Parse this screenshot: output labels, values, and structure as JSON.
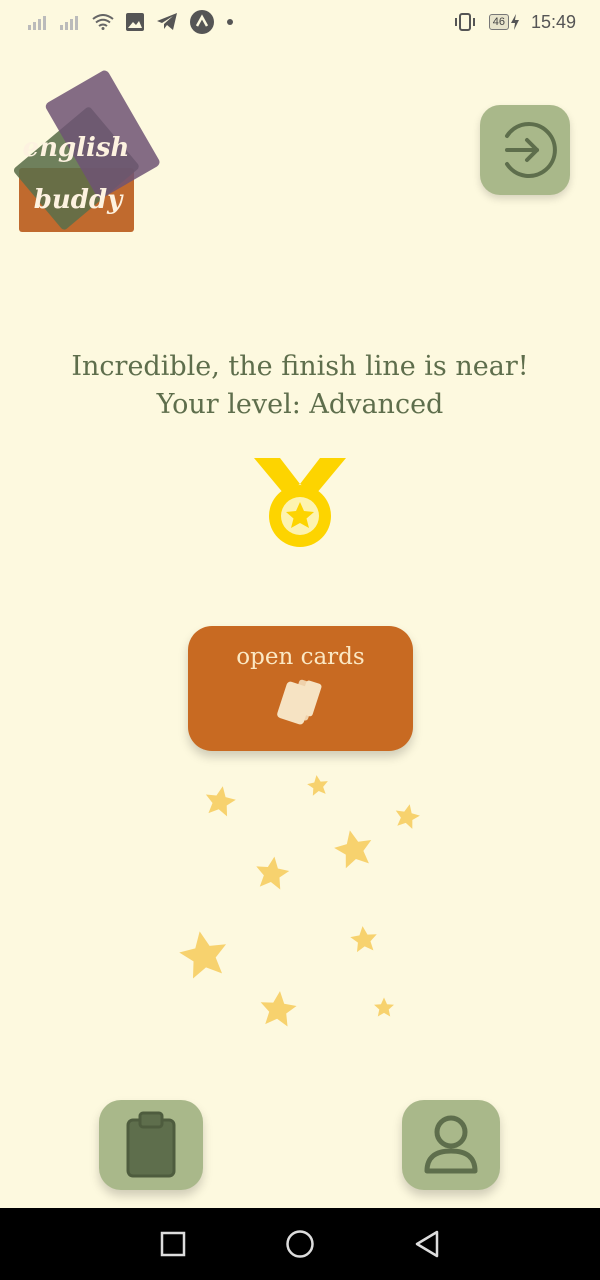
{
  "status_bar": {
    "time": "15:49",
    "battery_level": "46",
    "icons": [
      "signal-icon",
      "signal-icon",
      "wifi-icon",
      "image-icon",
      "telegram-icon",
      "app-icon",
      "dot-icon",
      "vibrate-icon",
      "battery-icon",
      "charging-icon"
    ]
  },
  "logo": {
    "line1": "english",
    "line2": "buddy",
    "colors": {
      "purple": "#6e5474",
      "green": "#5b6e4a",
      "orange": "#c06a2e"
    }
  },
  "header": {
    "login_icon": "login-arrow-icon"
  },
  "main": {
    "headline": "Incredible, the finish line is near!",
    "level_text": "Your level: Advanced",
    "medal_icon": "medal-icon",
    "open_cards_label": "open cards",
    "cards_icon": "cards-icon"
  },
  "bottom_nav": {
    "left_icon": "clipboard-icon",
    "right_icon": "user-icon"
  },
  "system_nav": [
    "recent-apps-icon",
    "home-icon",
    "back-icon"
  ],
  "colors": {
    "background": "#fdf9df",
    "accent_green": "#a9b88a",
    "dark_green": "#5e6e4c",
    "orange": "#c86a22",
    "star": "#f7d26e",
    "medal": "#fdd400"
  }
}
